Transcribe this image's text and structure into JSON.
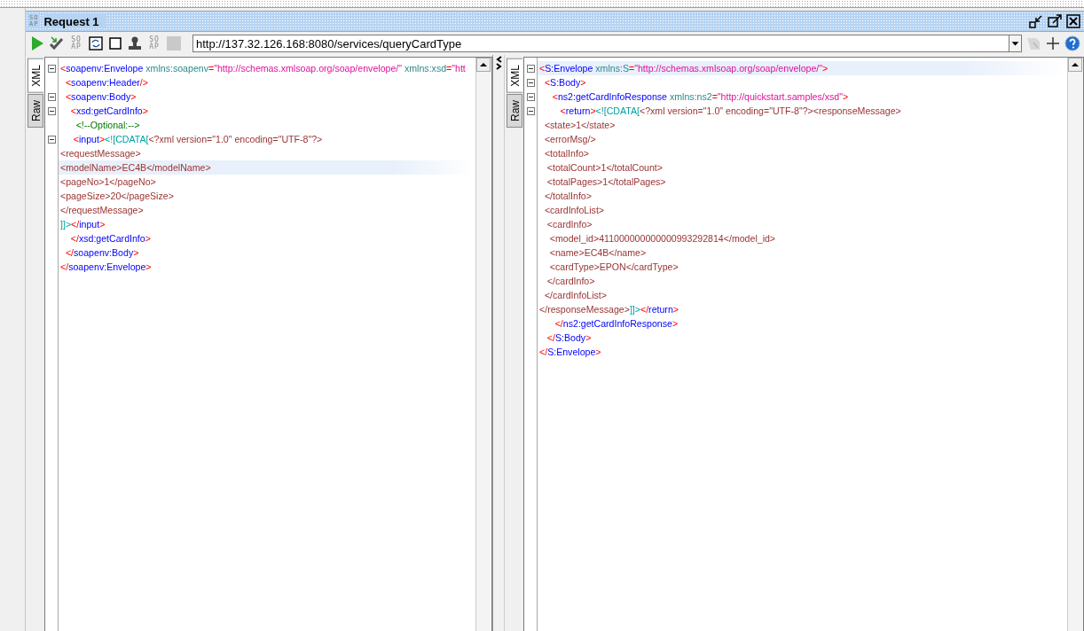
{
  "window": {
    "title": "Request 1",
    "logo": [
      "SO",
      "AP"
    ]
  },
  "toolbar": [
    {
      "kind": "run",
      "disabled": false
    },
    {
      "kind": "check",
      "disabled": false
    },
    {
      "kind": "soap",
      "lines": [
        "SO",
        "AP"
      ],
      "disabled": false
    },
    {
      "kind": "frame",
      "disabled": false
    },
    {
      "kind": "square",
      "disabled": false
    },
    {
      "kind": "stamp",
      "disabled": false
    },
    {
      "kind": "soap",
      "lines": [
        "SO",
        "AP"
      ],
      "disabled": false
    },
    {
      "kind": "stop",
      "disabled": true
    }
  ],
  "endpoint": {
    "value": "http://137.32.126.168:8080/services/queryCardType"
  },
  "toolbar_right": [
    {
      "kind": "tag",
      "disabled": true
    },
    {
      "kind": "plus",
      "disabled": false
    },
    {
      "kind": "help",
      "disabled": false
    }
  ],
  "request": {
    "tabs": [
      {
        "label": "XML",
        "selected": true
      },
      {
        "label": "Raw",
        "selected": false
      }
    ],
    "lines": [
      {
        "fold": true,
        "highlighted": false,
        "tokens": [
          {
            "kind": "punct",
            "text": "<"
          },
          {
            "kind": "name",
            "text": "soapenv:Envelope"
          },
          {
            "kind": "attr",
            "text": " xmlns:soapenv"
          },
          {
            "kind": "punct",
            "text": "="
          },
          {
            "kind": "value",
            "text": "\"http://schemas.xmlsoap.org/soap/envelope/\""
          },
          {
            "kind": "attr",
            "text": " xmlns:xsd"
          },
          {
            "kind": "punct",
            "text": "="
          },
          {
            "kind": "value",
            "text": "\"htt"
          }
        ]
      },
      {
        "fold": false,
        "highlighted": false,
        "tokens": [
          {
            "kind": "punct",
            "text": "  <"
          },
          {
            "kind": "name",
            "text": "soapenv:Header"
          },
          {
            "kind": "punct",
            "text": "/>"
          }
        ]
      },
      {
        "fold": true,
        "highlighted": false,
        "tokens": [
          {
            "kind": "punct",
            "text": "  <"
          },
          {
            "kind": "name",
            "text": "soapenv:Body"
          },
          {
            "kind": "punct",
            "text": ">"
          }
        ]
      },
      {
        "fold": true,
        "highlighted": false,
        "tokens": [
          {
            "kind": "punct",
            "text": "    <"
          },
          {
            "kind": "name",
            "text": "xsd:getCardInfo"
          },
          {
            "kind": "punct",
            "text": ">"
          }
        ]
      },
      {
        "fold": false,
        "highlighted": false,
        "tokens": [
          {
            "kind": "comment",
            "text": "      <!--Optional:-->"
          }
        ]
      },
      {
        "fold": true,
        "highlighted": false,
        "tokens": [
          {
            "kind": "punct",
            "text": "     <"
          },
          {
            "kind": "name",
            "text": "input"
          },
          {
            "kind": "punct",
            "text": ">"
          },
          {
            "kind": "cdata",
            "text": "<![CDATA["
          },
          {
            "kind": "text",
            "text": "<?xml version=\"1.0\" encoding=\"UTF-8\"?>"
          }
        ]
      },
      {
        "fold": false,
        "highlighted": false,
        "tokens": [
          {
            "kind": "text",
            "text": "<requestMessage>"
          }
        ]
      },
      {
        "fold": false,
        "highlighted": true,
        "tokens": [
          {
            "kind": "text",
            "text": "<modelName>EC4B</modelName>"
          }
        ]
      },
      {
        "fold": false,
        "highlighted": false,
        "tokens": [
          {
            "kind": "text",
            "text": "<pageNo>1</pageNo>"
          }
        ]
      },
      {
        "fold": false,
        "highlighted": false,
        "tokens": [
          {
            "kind": "text",
            "text": "<pageSize>20</pageSize>"
          }
        ]
      },
      {
        "fold": false,
        "highlighted": false,
        "tokens": [
          {
            "kind": "text",
            "text": "</requestMessage>"
          }
        ]
      },
      {
        "fold": false,
        "highlighted": false,
        "tokens": [
          {
            "kind": "cdata",
            "text": "]]>"
          },
          {
            "kind": "punct",
            "text": "</"
          },
          {
            "kind": "name",
            "text": "input"
          },
          {
            "kind": "punct",
            "text": ">"
          }
        ]
      },
      {
        "fold": false,
        "highlighted": false,
        "tokens": [
          {
            "kind": "punct",
            "text": "    </"
          },
          {
            "kind": "name",
            "text": "xsd:getCardInfo"
          },
          {
            "kind": "punct",
            "text": ">"
          }
        ]
      },
      {
        "fold": false,
        "highlighted": false,
        "tokens": [
          {
            "kind": "punct",
            "text": "  </"
          },
          {
            "kind": "name",
            "text": "soapenv:Body"
          },
          {
            "kind": "punct",
            "text": ">"
          }
        ]
      },
      {
        "fold": false,
        "highlighted": false,
        "tokens": [
          {
            "kind": "punct",
            "text": "</"
          },
          {
            "kind": "name",
            "text": "soapenv:Envelope"
          },
          {
            "kind": "punct",
            "text": ">"
          }
        ]
      }
    ]
  },
  "response": {
    "tabs": [
      {
        "label": "XML",
        "selected": true
      },
      {
        "label": "Raw",
        "selected": false
      }
    ],
    "lines": [
      {
        "fold": true,
        "highlighted": true,
        "tokens": [
          {
            "kind": "punct",
            "text": "<"
          },
          {
            "kind": "name",
            "text": "S:Envelope"
          },
          {
            "kind": "attr",
            "text": " xmlns:S"
          },
          {
            "kind": "punct",
            "text": "="
          },
          {
            "kind": "value",
            "text": "\"http://schemas.xmlsoap.org/soap/envelope/\""
          },
          {
            "kind": "punct",
            "text": ">"
          }
        ]
      },
      {
        "fold": true,
        "highlighted": false,
        "tokens": [
          {
            "kind": "punct",
            "text": "  <"
          },
          {
            "kind": "name",
            "text": "S:Body"
          },
          {
            "kind": "punct",
            "text": ">"
          }
        ]
      },
      {
        "fold": true,
        "highlighted": false,
        "tokens": [
          {
            "kind": "punct",
            "text": "     <"
          },
          {
            "kind": "name",
            "text": "ns2:getCardInfoResponse"
          },
          {
            "kind": "attr",
            "text": " xmlns:ns2"
          },
          {
            "kind": "punct",
            "text": "="
          },
          {
            "kind": "value",
            "text": "\"http://quickstart.samples/xsd\""
          },
          {
            "kind": "punct",
            "text": ">"
          }
        ]
      },
      {
        "fold": true,
        "highlighted": false,
        "tokens": [
          {
            "kind": "punct",
            "text": "        <"
          },
          {
            "kind": "name",
            "text": "return"
          },
          {
            "kind": "punct",
            "text": ">"
          },
          {
            "kind": "cdata",
            "text": "<![CDATA["
          },
          {
            "kind": "text",
            "text": "<?xml version=\"1.0\" encoding=\"UTF-8\"?><responseMessage>"
          }
        ]
      },
      {
        "fold": false,
        "highlighted": false,
        "tokens": [
          {
            "kind": "text",
            "text": "  <state>1</state>"
          }
        ]
      },
      {
        "fold": false,
        "highlighted": false,
        "tokens": [
          {
            "kind": "text",
            "text": "  <errorMsg/>"
          }
        ]
      },
      {
        "fold": false,
        "highlighted": false,
        "tokens": [
          {
            "kind": "text",
            "text": "  <totalInfo>"
          }
        ]
      },
      {
        "fold": false,
        "highlighted": false,
        "tokens": [
          {
            "kind": "text",
            "text": "   <totalCount>1</totalCount>"
          }
        ]
      },
      {
        "fold": false,
        "highlighted": false,
        "tokens": [
          {
            "kind": "text",
            "text": "   <totalPages>1</totalPages>"
          }
        ]
      },
      {
        "fold": false,
        "highlighted": false,
        "tokens": [
          {
            "kind": "text",
            "text": "  </totalInfo>"
          }
        ]
      },
      {
        "fold": false,
        "highlighted": false,
        "tokens": [
          {
            "kind": "text",
            "text": "  <cardInfoList>"
          }
        ]
      },
      {
        "fold": false,
        "highlighted": false,
        "tokens": [
          {
            "kind": "text",
            "text": "   <cardInfo>"
          }
        ]
      },
      {
        "fold": false,
        "highlighted": false,
        "tokens": [
          {
            "kind": "text",
            "text": "    <model_id>411000000000000993292814</model_id>"
          }
        ]
      },
      {
        "fold": false,
        "highlighted": false,
        "tokens": [
          {
            "kind": "text",
            "text": "    <name>EC4B</name>"
          }
        ]
      },
      {
        "fold": false,
        "highlighted": false,
        "tokens": [
          {
            "kind": "text",
            "text": "    <cardType>EPON</cardType>"
          }
        ]
      },
      {
        "fold": false,
        "highlighted": false,
        "tokens": [
          {
            "kind": "text",
            "text": "   </cardInfo>"
          }
        ]
      },
      {
        "fold": false,
        "highlighted": false,
        "tokens": [
          {
            "kind": "text",
            "text": "  </cardInfoList>"
          }
        ]
      },
      {
        "fold": false,
        "highlighted": false,
        "tokens": [
          {
            "kind": "text",
            "text": "</responseMessage>"
          },
          {
            "kind": "cdata",
            "text": "]]>"
          },
          {
            "kind": "punct",
            "text": "</"
          },
          {
            "kind": "name",
            "text": "return"
          },
          {
            "kind": "punct",
            "text": ">"
          }
        ]
      },
      {
        "fold": false,
        "highlighted": false,
        "tokens": [
          {
            "kind": "punct",
            "text": "      </"
          },
          {
            "kind": "name",
            "text": "ns2:getCardInfoResponse"
          },
          {
            "kind": "punct",
            "text": ">"
          }
        ]
      },
      {
        "fold": false,
        "highlighted": false,
        "tokens": [
          {
            "kind": "punct",
            "text": "   </"
          },
          {
            "kind": "name",
            "text": "S:Body"
          },
          {
            "kind": "punct",
            "text": ">"
          }
        ]
      },
      {
        "fold": false,
        "highlighted": false,
        "tokens": [
          {
            "kind": "punct",
            "text": "</"
          },
          {
            "kind": "name",
            "text": "S:Envelope"
          },
          {
            "kind": "punct",
            "text": ">"
          }
        ]
      }
    ]
  }
}
